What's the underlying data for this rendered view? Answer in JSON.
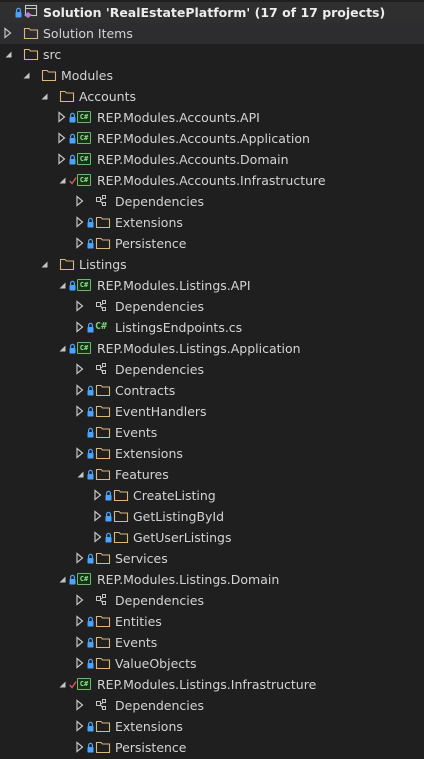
{
  "solution": {
    "title": "Solution 'RealEstatePlatform' (17 of 17 projects)"
  },
  "solution_items": {
    "label": "Solution Items"
  },
  "src": {
    "label": "src"
  },
  "modules": {
    "label": "Modules"
  },
  "accounts": {
    "label": "Accounts",
    "api": "REP.Modules.Accounts.API",
    "application": "REP.Modules.Accounts.Application",
    "domain": "REP.Modules.Accounts.Domain",
    "infrastructure": "REP.Modules.Accounts.Infrastructure",
    "infra_children": [
      "Dependencies",
      "Extensions",
      "Persistence"
    ]
  },
  "listings": {
    "label": "Listings",
    "api": "REP.Modules.Listings.API",
    "api_children": [
      "Dependencies",
      "ListingsEndpoints.cs"
    ],
    "application": "REP.Modules.Listings.Application",
    "app_children": [
      "Dependencies",
      "Contracts",
      "EventHandlers",
      "Events",
      "Extensions",
      "Features",
      "Services"
    ],
    "features_children": [
      "CreateListing",
      "GetListingById",
      "GetUserListings"
    ],
    "domain": "REP.Modules.Listings.Domain",
    "domain_children": [
      "Dependencies",
      "Entities",
      "Events",
      "ValueObjects"
    ],
    "infrastructure": "REP.Modules.Listings.Infrastructure",
    "infra_children": [
      "Dependencies",
      "Extensions",
      "Persistence"
    ]
  },
  "icons": {
    "project": "C#",
    "file": "C#"
  }
}
